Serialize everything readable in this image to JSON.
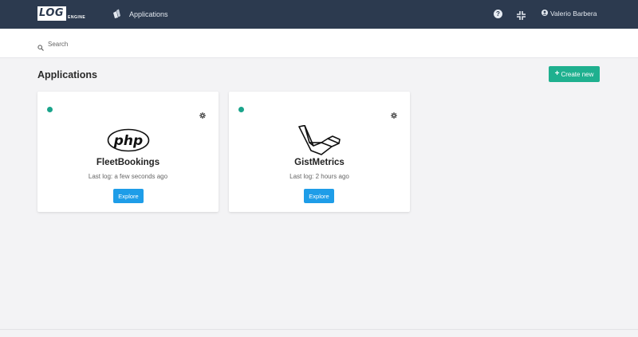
{
  "navbar": {
    "logo_text": "LOG",
    "logo_subtext": "ENGINE",
    "apps_link": "Applications",
    "help_symbol": "?",
    "user_name": "Valerio Barbera"
  },
  "search": {
    "placeholder": "Search",
    "value": ""
  },
  "page": {
    "title": "Applications",
    "create_button": "Create new",
    "create_icon": "+"
  },
  "applications": [
    {
      "name": "FleetBookings",
      "logo": "php-logo",
      "logo_text": "php",
      "last_log": "Last log: a few seconds ago",
      "action": "Explore",
      "status_color": "#1aa48b"
    },
    {
      "name": "GistMetrics",
      "logo": "laravel-logo",
      "last_log": "Last log: 2 hours ago",
      "action": "Explore",
      "status_color": "#1aa48b"
    }
  ],
  "colors": {
    "navbar": "#2c3a4f",
    "accent_green": "#1fb08f",
    "accent_blue": "#1e9de8",
    "background": "#f3f3f5"
  }
}
